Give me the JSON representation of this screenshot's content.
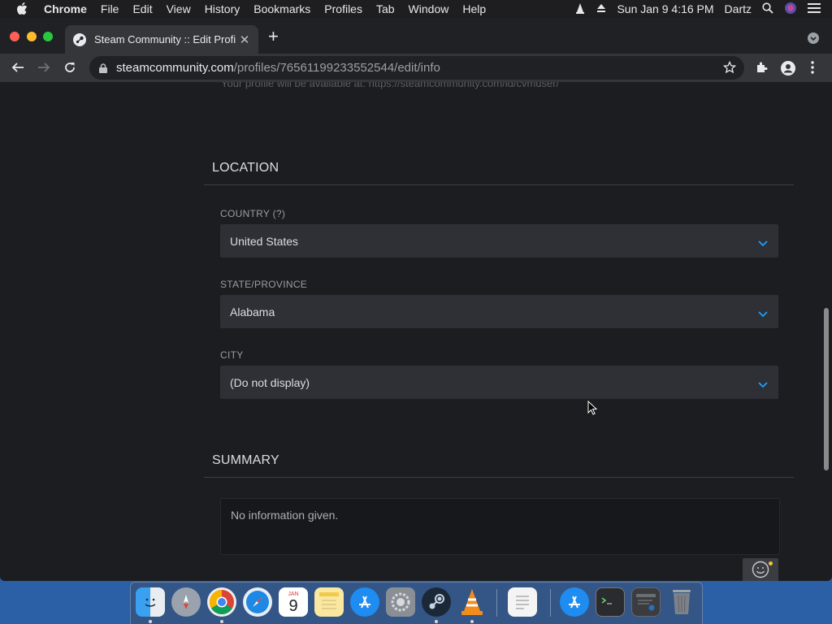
{
  "menubar": {
    "app_name": "Chrome",
    "items": [
      "File",
      "Edit",
      "View",
      "History",
      "Bookmarks",
      "Profiles",
      "Tab",
      "Window",
      "Help"
    ],
    "clock": "Sun Jan 9  4:16 PM",
    "user": "Dartz"
  },
  "browser": {
    "tab_title": "Steam Community :: Edit Profil",
    "url_host": "steamcommunity.com",
    "url_path": "/profiles/76561199233552544/edit/info"
  },
  "page": {
    "faded_top_text": "Your profile will be available at: https://steamcommunity.com/id/cvmuser/",
    "location_section": {
      "title": "LOCATION",
      "country": {
        "label": "COUNTRY (?)",
        "value": "United States"
      },
      "state": {
        "label": "STATE/PROVINCE",
        "value": "Alabama"
      },
      "city": {
        "label": "CITY",
        "value": "(Do not display)"
      }
    },
    "summary_section": {
      "title": "SUMMARY",
      "text": "No information given."
    }
  },
  "dock": {
    "icons": [
      "finder-icon",
      "launchpad-icon",
      "chrome-icon",
      "safari-icon",
      "calendar-icon",
      "notes-icon",
      "app-store-icon",
      "system-preferences-icon",
      "steam-icon",
      "vlc-icon",
      "textedit-icon",
      "app-store-downloads-icon",
      "terminal-icon",
      "steam-window-icon",
      "trash-icon"
    ],
    "calendar_month": "JAN",
    "calendar_day": "9"
  },
  "colors": {
    "accent_blue": "#1a9fff",
    "page_bg": "#1b1d20",
    "select_bg": "#2e3035"
  }
}
